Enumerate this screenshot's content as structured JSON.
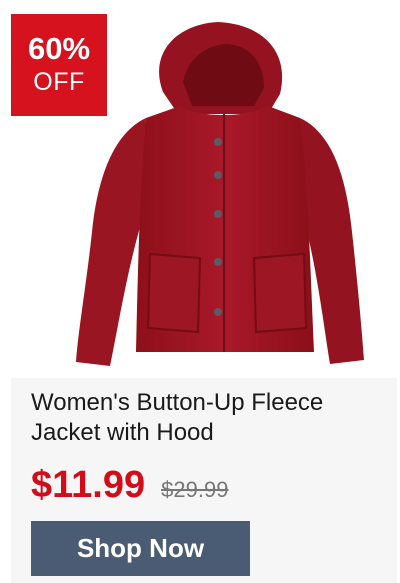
{
  "badge": {
    "percent": "60%",
    "off": "OFF"
  },
  "product": {
    "image_icon": "fleece-jacket-image",
    "title": "Women's Button-Up Fleece Jacket with Hood",
    "sale_price": "$11.99",
    "original_price": "$29.99"
  },
  "cta": {
    "label": "Shop Now"
  },
  "colors": {
    "badge_red": "#d5121d",
    "price_red": "#d10d1a",
    "button_slate": "#4a5b74",
    "jacket_red": "#a3161f"
  }
}
